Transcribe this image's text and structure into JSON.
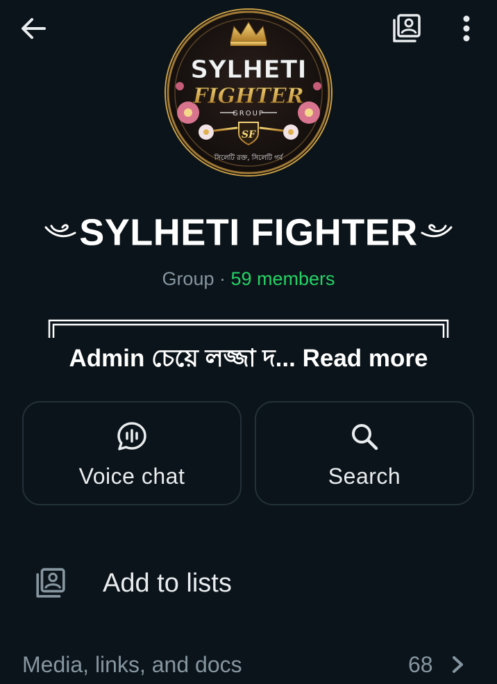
{
  "header": {
    "back_icon": "arrow-left-icon",
    "lists_icon": "lists-icon",
    "menu_icon": "more-vertical-icon"
  },
  "avatar": {
    "logo_title_line1": "SYLHETI",
    "logo_title_line2": "FIGHTER",
    "logo_group_word": "GROUP",
    "logo_monogram": "SF",
    "logo_tagline": "সিলেটি রক্ত, সিলেটি গর্ব"
  },
  "group": {
    "title": "SYLHETI FIGHTER",
    "type_label": "Group",
    "separator": " · ",
    "members_label": "59 members"
  },
  "description": {
    "text": "Admin চেয়ে লজ্জা  দ... Read more"
  },
  "actions": {
    "voice_chat_label": "Voice chat",
    "search_label": "Search"
  },
  "lists": {
    "add_label": "Add to lists"
  },
  "media": {
    "label": "Media, links, and docs",
    "count": "68"
  },
  "colors": {
    "background": "#0b141a",
    "accent_green": "#25d366",
    "secondary_text": "#8696a0",
    "card_border": "#233138"
  }
}
